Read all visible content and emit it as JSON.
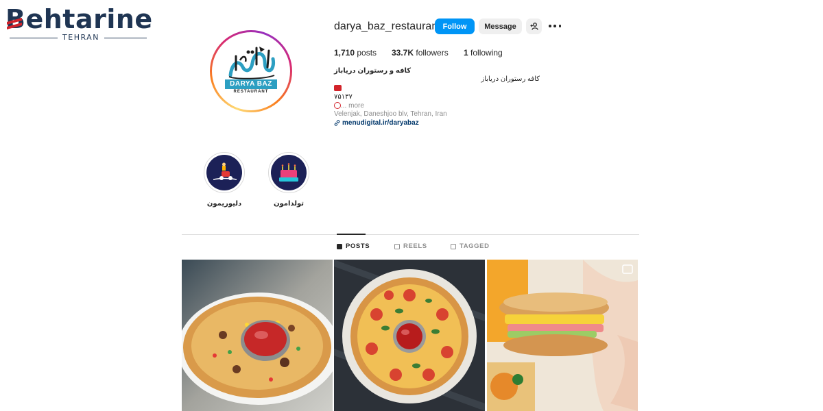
{
  "watermark": {
    "brand": "Behtarine",
    "city": "TEHRAN"
  },
  "profile": {
    "username": "darya_baz_restaurant",
    "avatar_logo_main": "DARYA BAZ",
    "avatar_logo_sub": "RESTAURANT",
    "buttons": {
      "follow": "Follow",
      "message": "Message"
    },
    "icons": {
      "add_user": "add-user-icon",
      "more": "more-options-icon"
    },
    "stats": {
      "posts_count": "1,710",
      "posts_label": "posts",
      "followers_count": "33.7K",
      "followers_label": "followers",
      "following_count": "1",
      "following_label": "following"
    },
    "bio": {
      "name": "کافه و رستوران دریاباز",
      "category": "کافه رستوران دریاباز",
      "phone": "۷۵۱۳۷",
      "more": "... more",
      "address": "Velenjak, Daneshjoo blv, Tehran, Iran",
      "link": "menudigital.ir/daryabaz"
    }
  },
  "highlights": [
    {
      "label": "دلیوریمون"
    },
    {
      "label": "تولدامون"
    }
  ],
  "tabs": [
    {
      "label": "POSTS",
      "icon": "grid-icon",
      "active": true
    },
    {
      "label": "REELS",
      "icon": "reels-icon",
      "active": false
    },
    {
      "label": "TAGGED",
      "icon": "tagged-icon",
      "active": false
    }
  ],
  "posts": [
    {
      "subject": "pizza-with-ketchup-cup",
      "type": "image"
    },
    {
      "subject": "margherita-pizza-on-dark-table",
      "type": "image"
    },
    {
      "subject": "sandwich-held-in-hand",
      "type": "reel"
    }
  ],
  "colors": {
    "follow_button": "#0095f6",
    "link": "#00376b",
    "brand_navy": "#1f3553",
    "brand_red": "#d2232a"
  }
}
